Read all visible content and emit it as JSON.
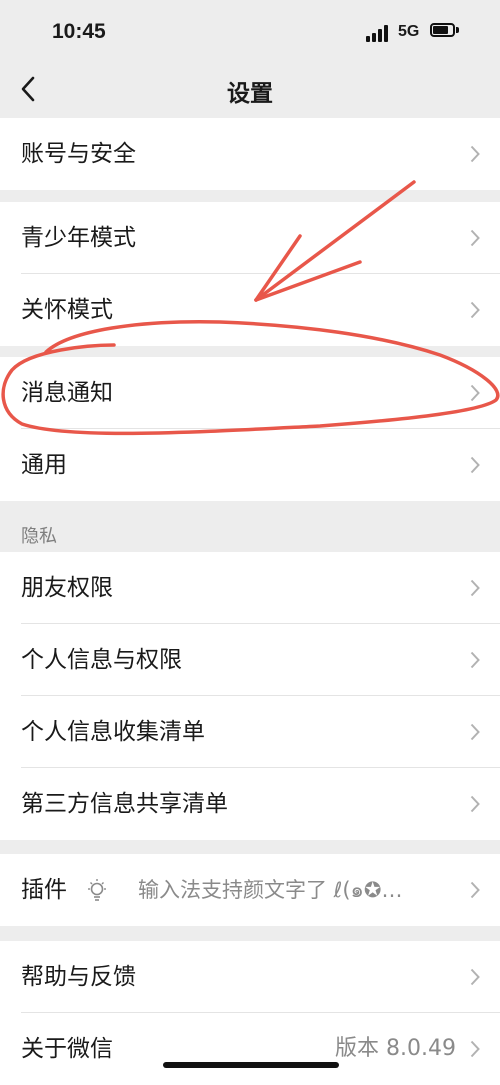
{
  "status": {
    "time": "10:45",
    "network": "5G"
  },
  "nav": {
    "title": "设置"
  },
  "groups": {
    "account": [
      "账号与安全"
    ],
    "modes": [
      "青少年模式",
      "关怀模式",
      "消息通知",
      "通用"
    ],
    "privacy_header": "隐私",
    "privacy": [
      "朋友权限",
      "个人信息与权限",
      "个人信息收集清单",
      "第三方信息共享清单"
    ],
    "plugins": {
      "label": "插件",
      "status_text": "输入法支持颜文字了 ℓ(๑✪…"
    },
    "help": [
      "帮助与反馈"
    ],
    "about": {
      "label": "关于微信",
      "version": "版本 8.0.49"
    }
  },
  "colors": {
    "background": "#ededed",
    "annotation": "#e8574a",
    "chevron": "#b2b2b2"
  },
  "icons": [
    "back-arrow-icon",
    "signal-icon",
    "battery-icon",
    "chevron-right-icon",
    "lightbulb-icon"
  ]
}
